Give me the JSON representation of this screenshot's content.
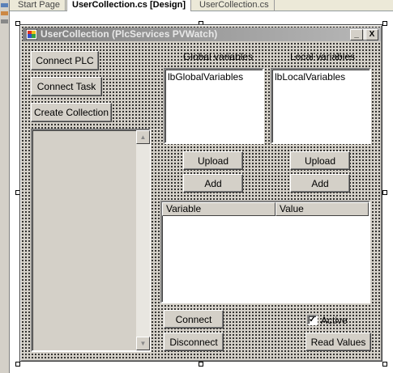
{
  "ide": {
    "tabs": [
      {
        "label": "Start Page"
      },
      {
        "label": "UserCollection.cs [Design]"
      },
      {
        "label": "UserCollection.cs"
      }
    ]
  },
  "form": {
    "title": "UserCollection (PlcServices PVWatch)",
    "caption_buttons": {
      "minimize": "_",
      "maximize": "□",
      "close": "X"
    },
    "buttons": {
      "connect_plc": "Connect PLC",
      "connect_task": "Connect Task",
      "create_collection": "Create Collection",
      "upload_global": "Upload",
      "add_global": "Add",
      "upload_local": "Upload",
      "add_local": "Add",
      "connect": "Connect",
      "disconnect": "Disconnect",
      "read_values": "Read Values"
    },
    "labels": {
      "global_variables": "Global variables",
      "local_variables": "Local variables"
    },
    "listboxes": {
      "global": "lbGlobalVariables",
      "local": "lbLocalVariables"
    },
    "listview": {
      "columns": [
        {
          "label": "Variable"
        },
        {
          "label": "Value"
        }
      ]
    },
    "scrollbar": {
      "up": "▲",
      "down": "▼"
    },
    "checkbox": {
      "label": "Active",
      "checked": true,
      "mark": "✓"
    }
  }
}
